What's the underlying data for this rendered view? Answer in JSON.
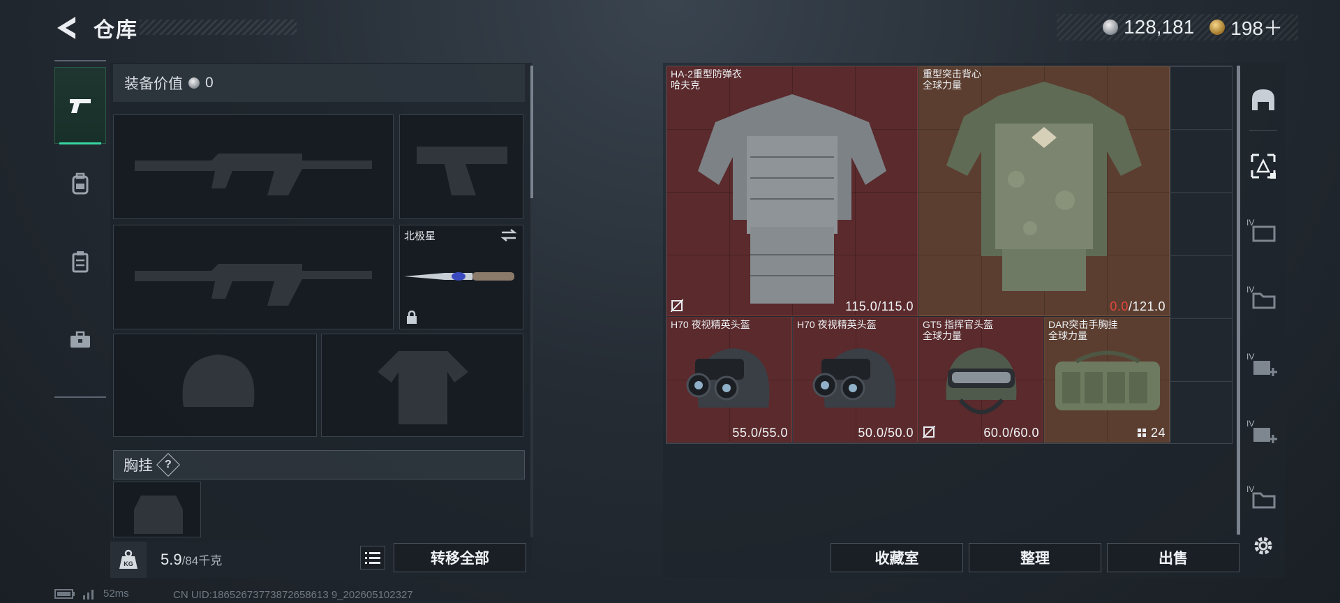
{
  "header": {
    "title": "仓库",
    "back_icon": "back-arrow-icon",
    "currency": [
      {
        "icon": "silver-coin-icon",
        "value": "128,181"
      },
      {
        "icon": "gold-coin-icon",
        "value": "198＋"
      }
    ]
  },
  "nav": {
    "items": [
      {
        "name": "weapon-tab",
        "icon": "pistol-icon",
        "active": true
      },
      {
        "name": "backpack-tab",
        "icon": "backpack-icon",
        "active": false
      },
      {
        "name": "container-tab",
        "icon": "case-icon",
        "active": false
      },
      {
        "name": "toolbox-tab",
        "icon": "toolbox-icon",
        "active": false
      }
    ]
  },
  "loadout": {
    "equip_value_label": "装备价值",
    "equip_value": "0",
    "melee_slot_name": "北极星",
    "chest_rig_label": "胸挂",
    "chest_rig_help": "?",
    "weight_current": "5.9",
    "weight_max": "/84千克",
    "weight_icon": "KG",
    "transfer_all": "转移全部"
  },
  "storage": {
    "items": [
      {
        "name": "HA-2重型防弹衣",
        "sub": "哈夫克",
        "value": "115.0/115.0",
        "low": ""
      },
      {
        "name": "重型突击背心",
        "sub": "全球力量",
        "value": "/121.0",
        "low": "0.0"
      },
      {
        "name": "H70 夜视精英头盔",
        "sub": "",
        "value": "55.0/55.0",
        "low": ""
      },
      {
        "name": "H70 夜视精英头盔",
        "sub": "",
        "value": "50.0/50.0",
        "low": ""
      },
      {
        "name": "GT5 指挥官头盔",
        "sub": "全球力量",
        "value": "60.0/60.0",
        "low": ""
      },
      {
        "name": "DAR突击手胸挂",
        "sub": "全球力量",
        "value": "24",
        "low": ""
      }
    ],
    "buttons": {
      "collection": "收藏室",
      "organize": "整理",
      "sell": "出售"
    },
    "tool_label": "IV"
  },
  "status": {
    "ping": "52ms",
    "uid": "CN UID:18652673773872658613 9_202605102327"
  },
  "colors": {
    "accent": "#38d6a0",
    "red_rarity": "#5a2a2c",
    "brown_rarity": "#5c3e30",
    "low_value": "#e0463e"
  }
}
